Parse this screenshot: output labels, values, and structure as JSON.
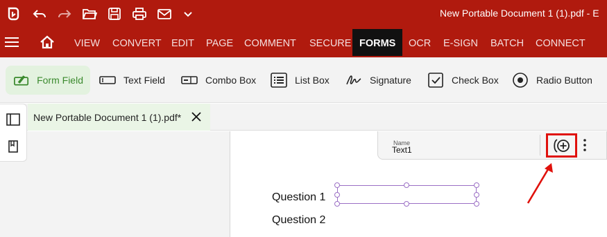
{
  "window": {
    "document_title": "New Portable Document 1 (1).pdf  -  E"
  },
  "quick_access": [
    {
      "name": "app-logo-icon"
    },
    {
      "name": "undo-icon"
    },
    {
      "name": "redo-icon"
    },
    {
      "name": "open-folder-icon"
    },
    {
      "name": "save-icon"
    },
    {
      "name": "print-icon"
    },
    {
      "name": "mail-icon"
    },
    {
      "name": "chevron-down-icon"
    }
  ],
  "menu": {
    "items": [
      "VIEW",
      "CONVERT",
      "EDIT",
      "PAGE",
      "COMMENT",
      "SECURE",
      "FORMS",
      "OCR",
      "E-SIGN",
      "BATCH",
      "CONNECT"
    ],
    "active": "FORMS"
  },
  "ribbon": {
    "items": [
      {
        "label": "Form Field",
        "icon": "form-field-icon",
        "active": true
      },
      {
        "label": "Text Field",
        "icon": "text-field-icon"
      },
      {
        "label": "Combo Box",
        "icon": "combo-box-icon"
      },
      {
        "label": "List Box",
        "icon": "list-box-icon"
      },
      {
        "label": "Signature",
        "icon": "signature-icon"
      },
      {
        "label": "Check Box",
        "icon": "check-box-icon"
      },
      {
        "label": "Radio Button",
        "icon": "radio-button-icon"
      }
    ]
  },
  "tab": {
    "label": "New Portable Document 1 (1).pdf*"
  },
  "property_bar": {
    "name_label": "Name",
    "name_value": "Text1"
  },
  "document": {
    "questions": [
      "Question 1",
      "Question 2"
    ]
  },
  "colors": {
    "brand": "#b01a0e",
    "active_green": "#3b8a2e",
    "highlight": "#e0110c",
    "field_border": "#9b6fc5"
  }
}
